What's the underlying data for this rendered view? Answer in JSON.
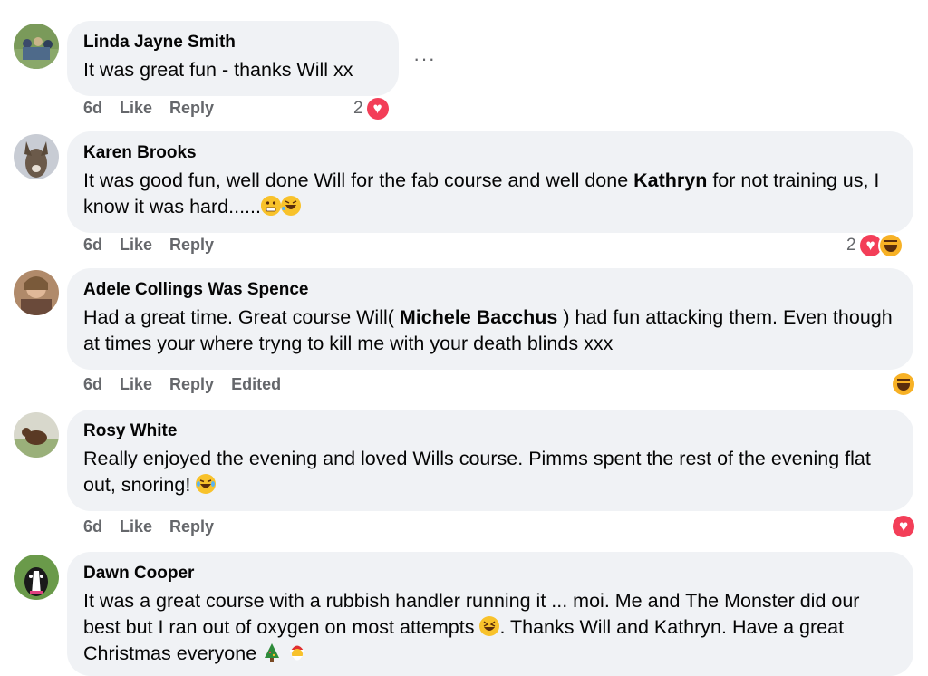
{
  "comments": [
    {
      "author": "Linda Jayne Smith",
      "text": "It was great fun - thanks Will xx",
      "time": "6d",
      "like": "Like",
      "reply": "Reply",
      "reaction_count": "2"
    },
    {
      "author": "Karen Brooks",
      "text_parts": [
        "It was good fun, well done Will for the fab course and well done ",
        "Kathryn",
        " for not training us, I know it was hard......"
      ],
      "time": "6d",
      "like": "Like",
      "reply": "Reply",
      "reaction_count": "2"
    },
    {
      "author": "Adele Collings Was Spence",
      "text_parts": [
        "Had a great time. Great course Will( ",
        "Michele Bacchus",
        " ) had fun attacking them. Even though at times your where tryng to kill me with your death blinds xxx"
      ],
      "time": "6d",
      "like": "Like",
      "reply": "Reply",
      "edited": "Edited"
    },
    {
      "author": "Rosy White",
      "text": "Really enjoyed the evening and loved Wills course. Pimms spent the rest of the evening flat out, snoring!",
      "time": "6d",
      "like": "Like",
      "reply": "Reply"
    },
    {
      "author": "Dawn Cooper",
      "text_parts": [
        "It was a great course with a rubbish handler running it ... moi. Me and The Monster did our best but I ran out of oxygen on most attempts",
        ". Thanks Will and Kathryn. Have a great Christmas everyone"
      ]
    }
  ],
  "more_options": "···",
  "colors": {
    "bubble": "#f0f2f5",
    "meta": "#65676b",
    "love": "#f33e58",
    "haha": "#f7b125"
  }
}
